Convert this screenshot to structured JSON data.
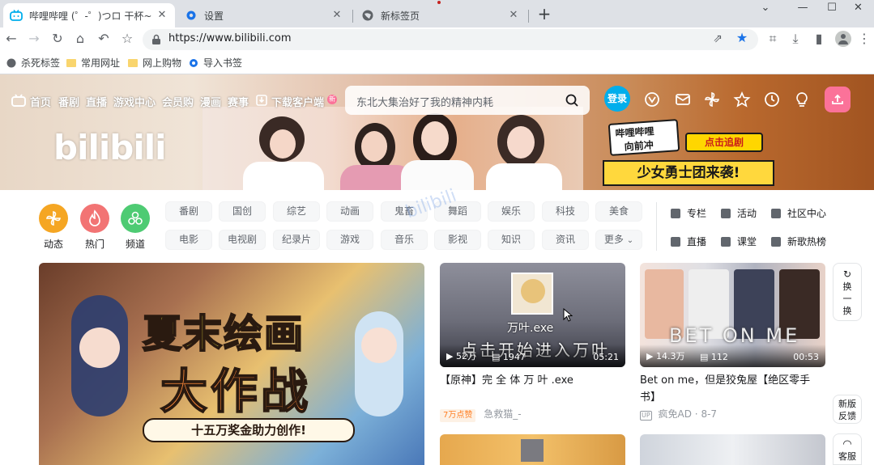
{
  "browser": {
    "tabs": [
      {
        "title": "哔哩哔哩 (゜-゜)つロ 干杯~-bili",
        "active": true,
        "icon": "bilibili-tv-icon"
      },
      {
        "title": "设置",
        "active": false,
        "icon": "gear-icon"
      },
      {
        "title": "新标签页",
        "active": false,
        "icon": "globe-icon"
      }
    ],
    "address": {
      "url": "https://www.bilibili.com"
    },
    "bookmarks": [
      {
        "label": "杀死标签",
        "icon": "globe-icon"
      },
      {
        "label": "常用网址",
        "icon": "folder-icon"
      },
      {
        "label": "网上购物",
        "icon": "folder-icon"
      },
      {
        "label": "导入书签",
        "icon": "gear-icon"
      }
    ]
  },
  "site": {
    "nav": [
      "首页",
      "番剧",
      "直播",
      "游戏中心",
      "会员购",
      "漫画",
      "赛事"
    ],
    "download": {
      "label": "下载客户端",
      "badge": "新"
    },
    "search": {
      "placeholder": "东北大集治好了我的精神内耗"
    },
    "login_label": "登录",
    "banner": {
      "logo_text": "bilibili",
      "promo_top": "哔哩哔哩",
      "promo_mid": "向前冲",
      "promo_button": "点击追剧",
      "promo_main": "少女勇士团来袭!"
    },
    "accent": "#fb7299",
    "blue": "#00aeec"
  },
  "channels": {
    "circles": [
      {
        "label": "动态",
        "color": "#f5a623",
        "icon": "pinwheel-icon"
      },
      {
        "label": "热门",
        "color": "#f27474",
        "icon": "flame-icon"
      },
      {
        "label": "频道",
        "color": "#4ecb73",
        "icon": "cluster-icon"
      }
    ],
    "row1": [
      "番剧",
      "国创",
      "综艺",
      "动画",
      "鬼畜",
      "舞蹈",
      "娱乐",
      "科技",
      "美食"
    ],
    "row2": [
      "电影",
      "电视剧",
      "纪录片",
      "游戏",
      "音乐",
      "影视",
      "知识",
      "资讯",
      "更多"
    ],
    "side": [
      {
        "label": "专栏",
        "icon": "article-icon"
      },
      {
        "label": "活动",
        "icon": "flag-icon"
      },
      {
        "label": "社区中心",
        "icon": "community-icon"
      },
      {
        "label": "直播",
        "icon": "live-icon"
      },
      {
        "label": "课堂",
        "icon": "classroom-icon"
      },
      {
        "label": "新歌热榜",
        "icon": "music-chart-icon"
      }
    ]
  },
  "carousel": {
    "title": "夏末绘画",
    "subtitle": "大作战",
    "caption": "十五万奖金助力创作!"
  },
  "videos": [
    {
      "thumb_avatar_text": "万叶.exe",
      "thumb_caption": "点击开始进入万叶",
      "views": "52万",
      "danmaku": "1947",
      "duration": "05:21",
      "title": "【原神】完 全 体 万 叶 .exe",
      "badge": "7万点赞",
      "author": "急救猫_-"
    },
    {
      "thumb_caption": "BET ON ME",
      "views": "14.3万",
      "danmaku": "112",
      "duration": "00:53",
      "title": "Bet on me，但是狡兔屋【绝区零手书】",
      "author": "疯免AD",
      "date": "8-7"
    }
  ],
  "float": {
    "refresh": "换一换",
    "feedback": "新版反馈",
    "service": "客服"
  },
  "watermark": "bilibili"
}
